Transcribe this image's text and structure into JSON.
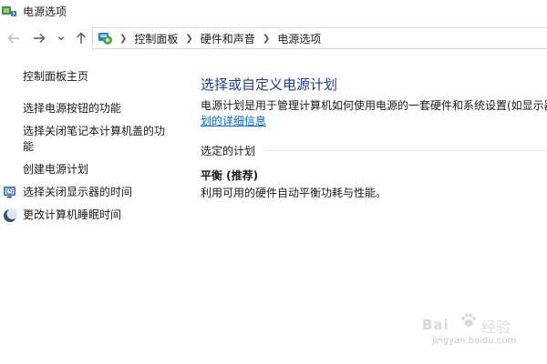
{
  "window": {
    "title": "电源选项",
    "app_icon": "power-options-icon"
  },
  "nav": {
    "back_icon": "arrow-left-icon",
    "forward_icon": "arrow-right-icon",
    "recent_icon": "chevron-down-icon",
    "up_icon": "arrow-up-icon"
  },
  "address": {
    "icon": "control-panel-icon",
    "breadcrumbs": [
      "控制面板",
      "硬件和声音",
      "电源选项"
    ]
  },
  "sidebar": {
    "home": "控制面板主页",
    "links": [
      {
        "label": "选择电源按钮的功能"
      },
      {
        "label": "选择关闭笔记本计算机盖的功能"
      },
      {
        "label": "创建电源计划"
      },
      {
        "label": "选择关闭显示器的时间",
        "icon": "monitor-clock-icon"
      },
      {
        "label": "更改计算机睡眠时间",
        "icon": "moon-icon"
      }
    ]
  },
  "main": {
    "heading": "选择或自定义电源计划",
    "description": "电源计划是用于管理计算机如何使用电源的一套硬件和系统设置(如显示器",
    "description_link": "划的详细信息",
    "section_label": "选定的计划",
    "plan_name": "平衡 (推荐)",
    "plan_description": "利用可用的硬件自动平衡功耗与性能。"
  },
  "watermark": {
    "brand": "Bai",
    "brand_cn": "经验",
    "site": "jingyan.baidu.com"
  },
  "colors": {
    "heading": "#1e3e8a",
    "link": "#0066cc",
    "text": "#1a1a1a"
  }
}
